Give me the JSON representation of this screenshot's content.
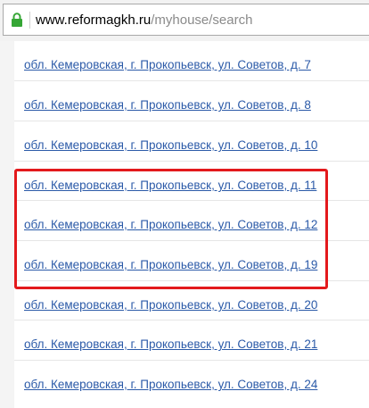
{
  "address_bar": {
    "url_host": "www.reformagkh.ru",
    "url_path": "/myhouse/search",
    "secure_icon": "lock-icon",
    "accent_color": "#35a635"
  },
  "results": {
    "link_color": "#2b5aa8",
    "items": [
      {
        "label": "обл. Кемеровская, г. Прокопьевск, ул. Советов, д. 7"
      },
      {
        "label": "обл. Кемеровская, г. Прокопьевск, ул. Советов, д. 8"
      },
      {
        "label": "обл. Кемеровская, г. Прокопьевск, ул. Советов, д. 10"
      },
      {
        "label": "обл. Кемеровская, г. Прокопьевск, ул. Советов, д. 11"
      },
      {
        "label": "обл. Кемеровская, г. Прокопьевск, ул. Советов, д. 12"
      },
      {
        "label": "обл. Кемеровская, г. Прокопьевск, ул. Советов, д. 19"
      },
      {
        "label": "обл. Кемеровская, г. Прокопьевск, ул. Советов, д. 20"
      },
      {
        "label": "обл. Кемеровская, г. Прокопьевск, ул. Советов, д. 21"
      },
      {
        "label": "обл. Кемеровская, г. Прокопьевск, ул. Советов, д. 24"
      }
    ]
  },
  "highlight": {
    "color": "#e3191c"
  }
}
